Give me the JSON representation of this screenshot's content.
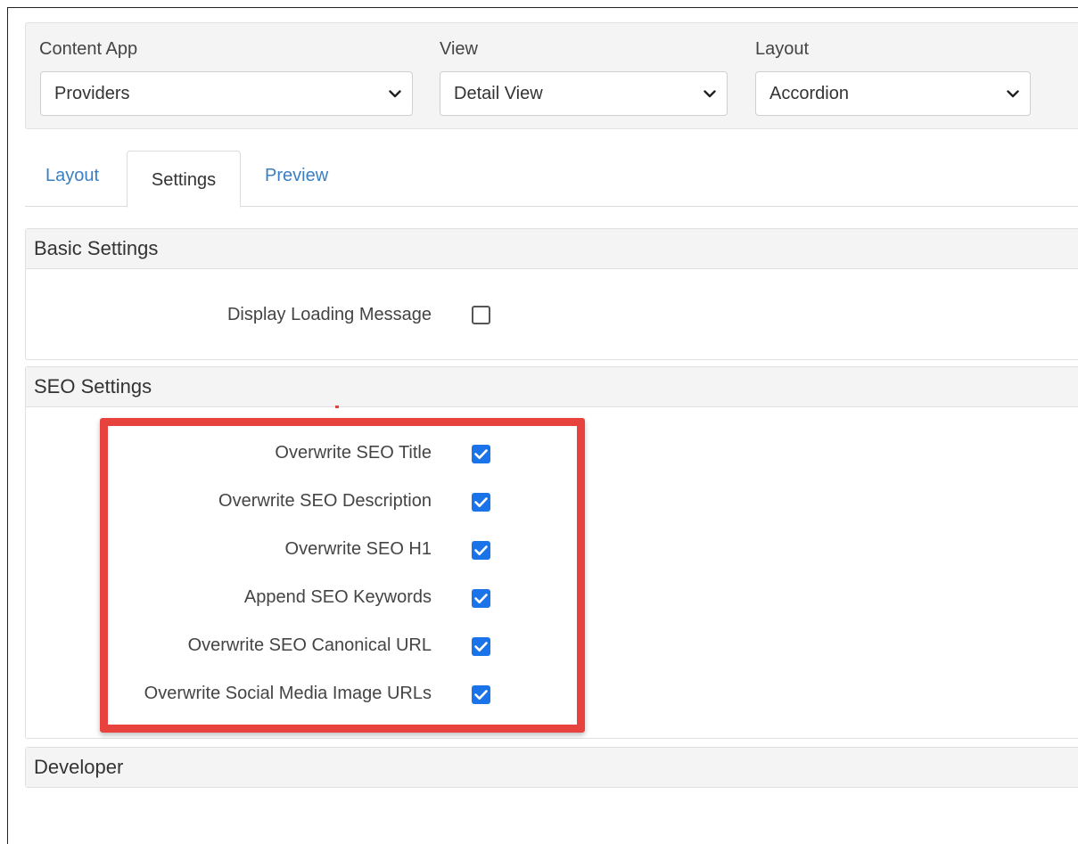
{
  "selectors": {
    "content_app": {
      "label": "Content App",
      "value": "Providers"
    },
    "view": {
      "label": "View",
      "value": "Detail View"
    },
    "layout": {
      "label": "Layout",
      "value": "Accordion"
    }
  },
  "tabs": [
    {
      "label": "Layout",
      "active": false
    },
    {
      "label": "Settings",
      "active": true
    },
    {
      "label": "Preview",
      "active": false
    }
  ],
  "sections": {
    "basic": {
      "title": "Basic Settings",
      "items": [
        {
          "label": "Display Loading Message",
          "checked": false
        }
      ]
    },
    "seo": {
      "title": "SEO Settings",
      "items": [
        {
          "label": "Overwrite SEO Title",
          "checked": true
        },
        {
          "label": "Overwrite SEO Description",
          "checked": true
        },
        {
          "label": "Overwrite SEO H1",
          "checked": true
        },
        {
          "label": "Append SEO Keywords",
          "checked": true
        },
        {
          "label": "Overwrite SEO Canonical URL",
          "checked": true
        },
        {
          "label": "Overwrite Social Media Image URLs",
          "checked": true
        }
      ]
    },
    "developer": {
      "title": "Developer"
    }
  },
  "colors": {
    "accent": "#1a73e8",
    "link": "#3a7fc2",
    "highlight": "#e8423f"
  },
  "icons": {
    "select_arrow": "chevron-down-icon",
    "check": "checkmark-icon"
  }
}
